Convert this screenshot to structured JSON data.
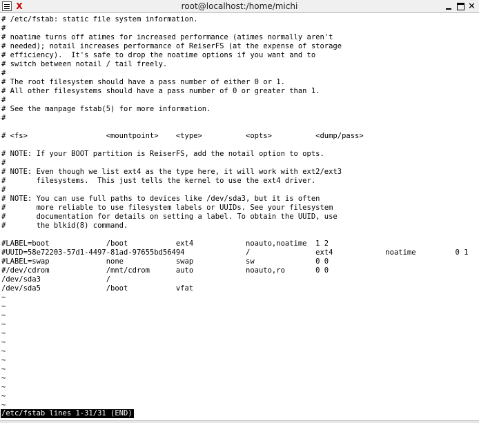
{
  "window": {
    "title": "root@localhost:/home/michi",
    "app_icon": "X",
    "close_glyph": "✕"
  },
  "terminal": {
    "lines": [
      "# /etc/fstab: static file system information.",
      "#",
      "# noatime turns off atimes for increased performance (atimes normally aren't",
      "# needed); notail increases performance of ReiserFS (at the expense of storage",
      "# efficiency).  It's safe to drop the noatime options if you want and to",
      "# switch between notail / tail freely.",
      "#",
      "# The root filesystem should have a pass number of either 0 or 1.",
      "# All other filesystems should have a pass number of 0 or greater than 1.",
      "#",
      "# See the manpage fstab(5) for more information.",
      "#",
      "",
      "# <fs>                  <mountpoint>    <type>          <opts>          <dump/pass>",
      "",
      "# NOTE: If your BOOT partition is ReiserFS, add the notail option to opts.",
      "#",
      "# NOTE: Even though we list ext4 as the type here, it will work with ext2/ext3",
      "#       filesystems.  This just tells the kernel to use the ext4 driver.",
      "#",
      "# NOTE: You can use full paths to devices like /dev/sda3, but it is often",
      "#       more reliable to use filesystem labels or UUIDs. See your filesystem",
      "#       documentation for details on setting a label. To obtain the UUID, use",
      "#       the blkid(8) command.",
      "",
      "#LABEL=boot             /boot           ext4            noauto,noatime  1 2",
      "#UUID=58e72203-57d1-4497-81ad-97655bd56494              /               ext4            noatime         0 1",
      "#LABEL=swap             none            swap            sw              0 0",
      "#/dev/cdrom             /mnt/cdrom      auto            noauto,ro       0 0",
      "/dev/sda3               /",
      "/dev/sda5               /boot           vfat",
      "~",
      "~",
      "~",
      "~",
      "~",
      "~",
      "~",
      "~",
      "~",
      "~",
      "~",
      "~",
      "~"
    ],
    "status": "/etc/fstab lines 1-31/31 (END)"
  }
}
